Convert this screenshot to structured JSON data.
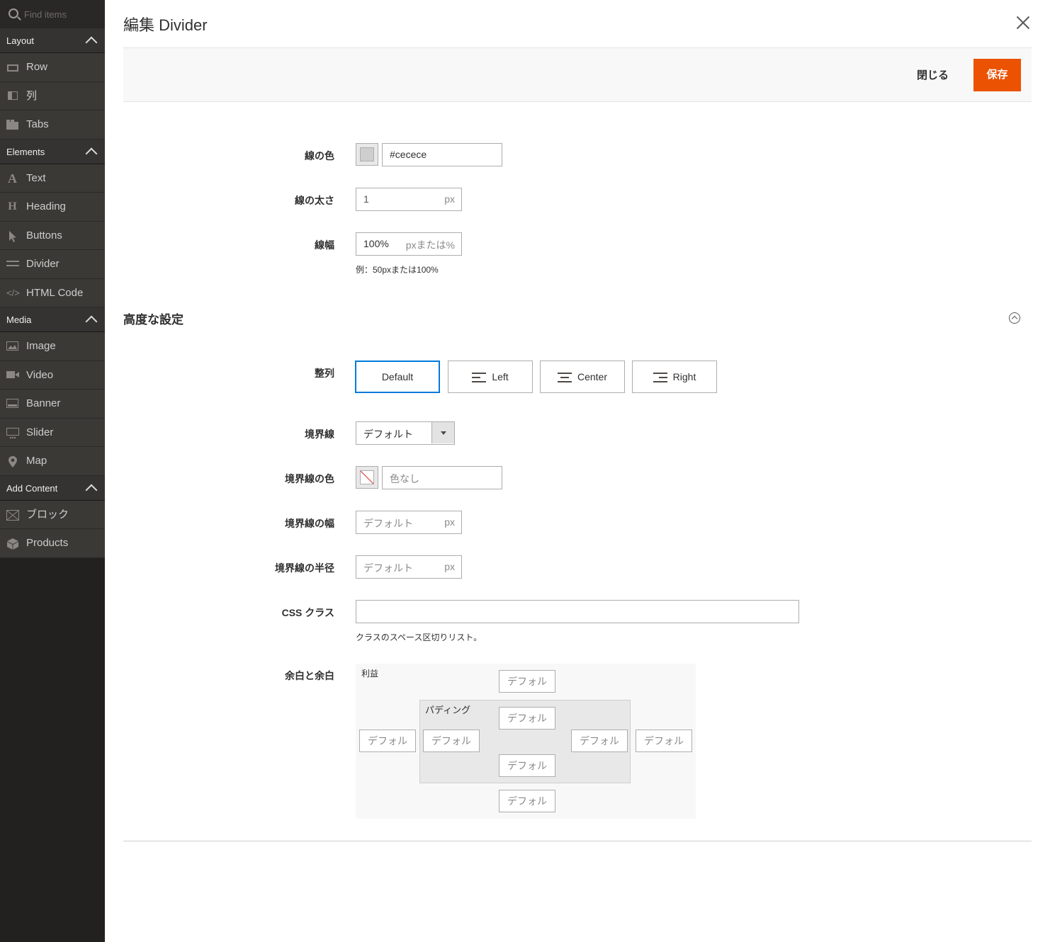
{
  "sidebar": {
    "search_placeholder": "Find items",
    "groups": [
      {
        "label": "Layout",
        "items": [
          {
            "label": "Row",
            "icon": "row-icon"
          },
          {
            "label": "列",
            "icon": "column-icon"
          },
          {
            "label": "Tabs",
            "icon": "tabs-icon"
          }
        ]
      },
      {
        "label": "Elements",
        "items": [
          {
            "label": "Text",
            "icon": "text-icon"
          },
          {
            "label": "Heading",
            "icon": "heading-icon"
          },
          {
            "label": "Buttons",
            "icon": "cursor-icon"
          },
          {
            "label": "Divider",
            "icon": "divider-icon"
          },
          {
            "label": "HTML Code",
            "icon": "code-icon"
          }
        ]
      },
      {
        "label": "Media",
        "items": [
          {
            "label": "Image",
            "icon": "image-icon"
          },
          {
            "label": "Video",
            "icon": "video-icon"
          },
          {
            "label": "Banner",
            "icon": "banner-icon"
          },
          {
            "label": "Slider",
            "icon": "slider-icon"
          },
          {
            "label": "Map",
            "icon": "map-pin-icon"
          }
        ]
      },
      {
        "label": "Add Content",
        "items": [
          {
            "label": "ブロック",
            "icon": "block-icon"
          },
          {
            "label": "Products",
            "icon": "products-icon"
          }
        ]
      }
    ]
  },
  "modal": {
    "title": "編集 Divider",
    "close_label": "閉じる",
    "save_label": "保存"
  },
  "form": {
    "line_color": {
      "label": "線の色",
      "value": "#cecece",
      "swatch": "#cecece"
    },
    "line_thickness": {
      "label": "線の太さ",
      "value": "1",
      "unit": "px"
    },
    "line_width": {
      "label": "線幅",
      "value": "100%",
      "unit": "pxまたは%",
      "note": "例：50pxまたは100%"
    }
  },
  "advanced": {
    "title": "高度な設定",
    "alignment": {
      "label": "整列",
      "options": [
        "Default",
        "Left",
        "Center",
        "Right"
      ],
      "selected": "Default"
    },
    "border": {
      "label": "境界線",
      "value": "デフォルト"
    },
    "border_color": {
      "label": "境界線の色",
      "placeholder": "色なし"
    },
    "border_width": {
      "label": "境界線の幅",
      "placeholder": "デフォルト",
      "unit": "px"
    },
    "border_radius": {
      "label": "境界線の半径",
      "placeholder": "デフォルト",
      "unit": "px"
    },
    "css_class": {
      "label": "CSS クラス",
      "value": "",
      "note": "クラスのスペース区切りリスト。"
    },
    "spacing": {
      "label": "余白と余白",
      "margin_label": "利益",
      "padding_label": "パディング",
      "placeholder": "デフォル"
    }
  },
  "colors": {
    "accent": "#eb5202",
    "selected_border": "#007bdb",
    "sidebar_bg": "#3b3936"
  }
}
